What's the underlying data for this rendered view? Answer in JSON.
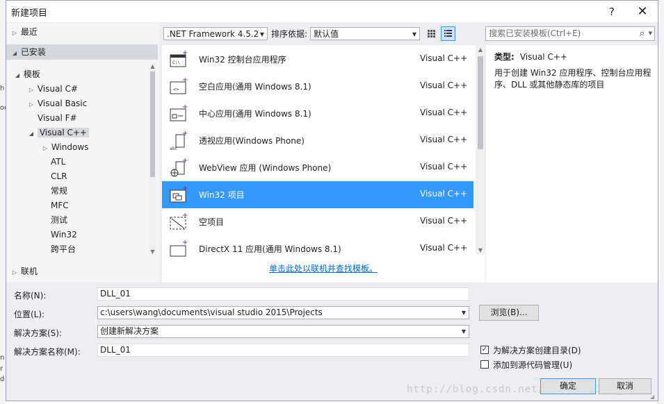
{
  "dialog": {
    "title": "新建项目",
    "help": "?",
    "close": "✕"
  },
  "nav": {
    "recent": "最近",
    "installed": "已安装",
    "templates": "模板",
    "items": [
      "Visual C#",
      "Visual Basic",
      "Visual F#",
      "Visual C++"
    ],
    "cpp_children": [
      "Windows",
      "ATL",
      "CLR",
      "常规",
      "MFC",
      "测试",
      "Win32",
      "跨平台"
    ],
    "online": "联机"
  },
  "toolbar": {
    "framework": ".NET Framework 4.5.2",
    "sort_label": "排序依据:",
    "sort_value": "默认值",
    "search_placeholder": "搜索已安装模板(Ctrl+E)"
  },
  "templates": [
    {
      "name": "Win32 控制台应用程序",
      "lang": "Visual C++",
      "icon": "console-app-icon"
    },
    {
      "name": "空白应用(通用 Windows 8.1)",
      "lang": "Visual C++",
      "icon": "blank-app-icon"
    },
    {
      "name": "中心应用(通用 Windows 8.1)",
      "lang": "Visual C++",
      "icon": "hub-app-icon"
    },
    {
      "name": "透视应用(Windows Phone)",
      "lang": "Visual C++",
      "icon": "pivot-app-icon"
    },
    {
      "name": "WebView 应用 (Windows Phone)",
      "lang": "Visual C++",
      "icon": "webview-app-icon"
    },
    {
      "name": "Win32 项目",
      "lang": "Visual C++",
      "icon": "win32-project-icon",
      "selected": true
    },
    {
      "name": "空项目",
      "lang": "Visual C++",
      "icon": "empty-project-icon"
    },
    {
      "name": "DirectX 11 应用(通用 Windows 8.1)",
      "lang": "Visual C++",
      "icon": "directx-app-icon"
    }
  ],
  "online_link": "单击此处以联机并查找模板。",
  "description": {
    "type_label": "类型:",
    "type_value": "Visual C++",
    "text": "用于创建 Win32 应用程序、控制台应用程序、DLL 或其他静态库的项目"
  },
  "form": {
    "name_label": "名称(N):",
    "name_value": "DLL_01",
    "location_label": "位置(L):",
    "location_value": "c:\\users\\wang\\documents\\visual studio 2015\\Projects",
    "browse": "浏览(B)...",
    "solution_label": "解决方案(S):",
    "solution_value": "创建新解决方案",
    "solution_name_label": "解决方案名称(M):",
    "solution_name_value": "DLL_01",
    "create_dir_label": "为解决方案创建目录(D)",
    "create_dir_checked": true,
    "source_control_label": "添加到源代码管理(U)",
    "source_control_checked": false,
    "ok": "确定",
    "cancel": "取消"
  },
  "watermark": "http://blog.csdn.net/wang1994398_401",
  "accent": "#3399ff"
}
